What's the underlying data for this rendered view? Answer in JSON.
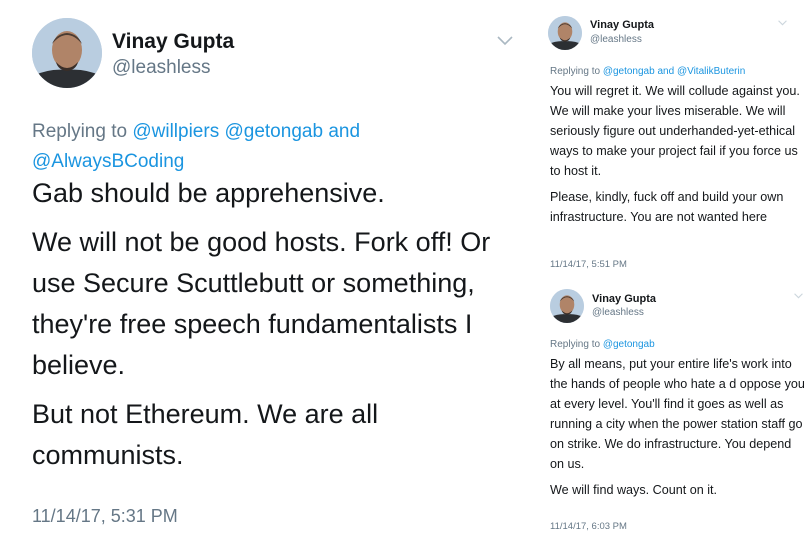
{
  "tweet_main": {
    "author_name": "Vinay Gupta",
    "author_handle": "@leashless",
    "reply_prefix": "Replying to",
    "reply_mentions": [
      "@willpiers",
      "@getongab"
    ],
    "reply_conj": "and",
    "reply_last": "@AlwaysBCoding",
    "paragraphs": [
      "Gab should be apprehensive.",
      "We will not be good hosts. Fork off! Or use Secure Scuttlebutt or something, they're free speech fundamentalists I believe.",
      "But not Ethereum. We are all communists."
    ],
    "timestamp": "11/14/17, 5:31 PM"
  },
  "tweet_r1": {
    "author_name": "Vinay Gupta",
    "author_handle": "@leashless",
    "reply_prefix": "Replying to",
    "reply_mentions": [
      "@getongab"
    ],
    "reply_conj": "and",
    "reply_last": "@VitalikButerin",
    "paragraphs": [
      "You will regret it. We will collude against you. We will make your lives miserable. We will seriously figure out underhanded-yet-ethical ways to make your project fail if you force us to host it.",
      "Please, kindly, fuck off and build your own infrastructure. You are not wanted here"
    ],
    "timestamp": "11/14/17, 5:51 PM"
  },
  "tweet_r2": {
    "author_name": "Vinay Gupta",
    "author_handle": "@leashless",
    "reply_prefix": "Replying to",
    "reply_last": "@getongab",
    "paragraphs": [
      "By all means, put your entire life's work into the hands of people who hate a d oppose you at every level. You'll find it goes as well as running a city when the power station staff go on strike. We do infrastructure. You depend on us.",
      "We will find ways. Count on it."
    ],
    "timestamp": "11/14/17, 6:03 PM"
  },
  "colors": {
    "text": "#14171a",
    "secondary": "#657786",
    "link": "#1b95e0"
  },
  "icons": {
    "caret": "chevron-down-icon",
    "avatar": "avatar-photo"
  }
}
